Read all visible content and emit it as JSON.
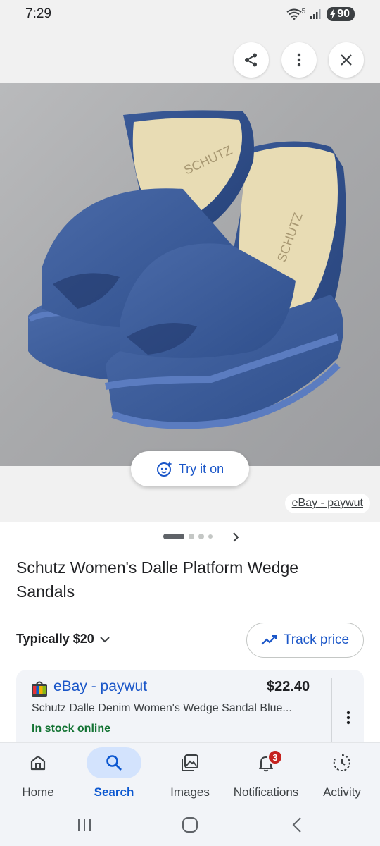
{
  "status_bar": {
    "time": "7:29",
    "network": "5",
    "battery": "90"
  },
  "top_bar": {
    "share_icon": "share-icon",
    "more_icon": "more-vert-icon",
    "close_icon": "close-icon"
  },
  "image": {
    "try_on_label": "Try it on",
    "source": "eBay - paywut",
    "carousel_total": 4,
    "carousel_current": 1
  },
  "product": {
    "title": "Schutz Women's Dalle Platform Wedge Sandals",
    "typical_price": "Typically $20",
    "track_price_label": "Track price"
  },
  "offer": {
    "seller": "eBay - paywut",
    "price": "$22.40",
    "description": "Schutz Dalle Denim Women's Wedge Sandal Blue...",
    "stock": "In stock online"
  },
  "bottom_nav": {
    "items": [
      {
        "label": "Home",
        "icon": "home-icon"
      },
      {
        "label": "Search",
        "icon": "search-icon",
        "active": true
      },
      {
        "label": "Images",
        "icon": "images-icon"
      },
      {
        "label": "Notifications",
        "icon": "bell-icon",
        "badge": "3"
      },
      {
        "label": "Activity",
        "icon": "activity-icon"
      }
    ]
  },
  "colors": {
    "accent": "#1a56c8",
    "in_stock": "#137333",
    "badge": "#c5221f",
    "denim": "#3f5f9c"
  }
}
